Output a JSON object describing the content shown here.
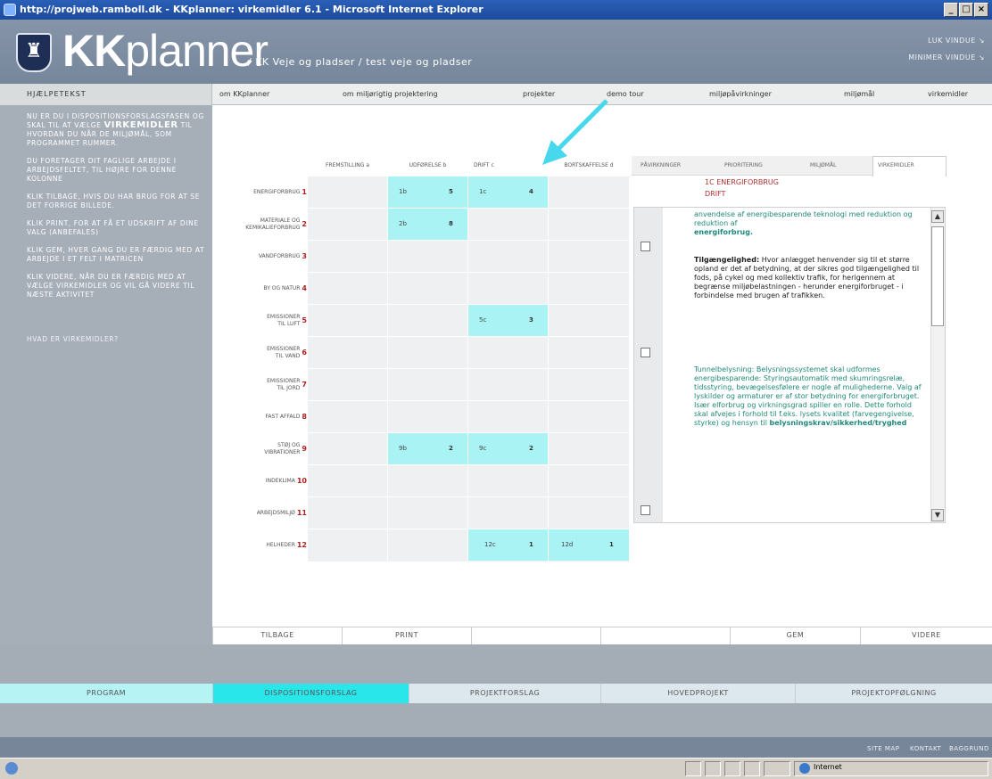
{
  "window": {
    "title": "http://projweb.ramboll.dk - KKplanner: virkemidler 6.1 - Microsoft Internet Explorer"
  },
  "header": {
    "brand_bold": "KK",
    "brand_light": "planner",
    "breadcrumb": "/ KK Veje og pladser  /  test veje og pladser",
    "close_window": "LUK VINDUE ↘",
    "minimize_window": "MINIMER VINDUE ↘",
    "logo": "♜"
  },
  "nav": {
    "help_heading": "HJÆLPETEKST",
    "links": [
      "om KKplanner",
      "om miljørigtig projektering",
      "projekter",
      "demo tour",
      "miljøpåvirkninger",
      "miljømål",
      "virkemidler"
    ]
  },
  "help": {
    "p1_pre": "NU ER DU I DISPOSITIONSFORSLAGSFASEN OG SKAL TIL AT VÆLGE",
    "p1_bold": "VIRKEMIDLER",
    "p1_post": "TIL HVORDAN DU NÅR DE MILJØMÅL, SOM PROGRAMMET RUMMER.",
    "p2": "DU FORETAGER DIT FAGLIGE ARBEJDE I ARBEJDSFELTET, TIL HØJRE FOR DENNE KOLONNE",
    "p3": "KLIK TILBAGE, HVIS DU HAR BRUG FOR AT SE DET FORRIGE BILLEDE.",
    "p4": "KLIK PRINT, FOR AT FÅ ET UDSKRIFT AF DINE VALG (ANBEFALES)",
    "p5": "KLIK GEM, HVER GANG DU ER FÆRDIG MED AT ARBEJDE I ET FELT I MATRICEN",
    "p6": "KLIK VIDERE, NÅR DU ER FÆRDIG MED AT VÆLGE VIRKEMIDLER OG VIL GÅ VIDERE TIL NÆSTE AKTIVITET",
    "link": "HVAD ER VIRKEMIDLER?"
  },
  "matrix": {
    "columns": [
      "FREMSTILLING a",
      "UDFØRELSE b",
      "DRIFT c",
      "BORTSKAFFELSE d"
    ],
    "rows": [
      {
        "label": "ENERGIFORBRUG",
        "num": "1"
      },
      {
        "label": "MATERIALE OG KEMIKALIEFORBRUG",
        "num": "2"
      },
      {
        "label": "VANDFORBRUG",
        "num": "3"
      },
      {
        "label": "BY OG NATUR",
        "num": "4"
      },
      {
        "label": "EMISSIONER TIL LUFT",
        "num": "5"
      },
      {
        "label": "EMISSIONER TIL VAND",
        "num": "6"
      },
      {
        "label": "EMISSIONER TIL JORD",
        "num": "7"
      },
      {
        "label": "FAST AFFALD",
        "num": "8"
      },
      {
        "label": "STØJ OG VIBRATIONER",
        "num": "9"
      },
      {
        "label": "INDEKLIMA",
        "num": "10"
      },
      {
        "label": "ARBEJDSMILJØ",
        "num": "11"
      },
      {
        "label": "HELHEDER",
        "num": "12"
      }
    ],
    "cells": [
      {
        "code": "1b",
        "count": "5"
      },
      {
        "code": "1c",
        "count": "4"
      },
      {
        "code": "2b",
        "count": "8"
      },
      {
        "code": "5c",
        "count": "3"
      },
      {
        "code": "9b",
        "count": "2"
      },
      {
        "code": "9c",
        "count": "2"
      },
      {
        "code": "12c",
        "count": "1"
      },
      {
        "code": "12d",
        "count": "1"
      }
    ]
  },
  "panel": {
    "tabs": [
      "PÅVIRKNINGER",
      "PRIORITERING",
      "MILJØMÅL",
      "VIRKEMIDLER"
    ],
    "heading1": "1C ENERGIFORBRUG",
    "heading2": "DRIFT",
    "t1": "anvendelse af energibesparende teknologi med reduktion og reduktion af",
    "t1b": "energiforbrug.",
    "t2_bold": "Tilgængelighed:",
    "t2": "Hvor anlægget henvender sig til et større opland er det af betydning, at der sikres god tilgængelighed til fods, på cykel og med kollektiv trafik, for herigennem at begrænse miljøbelastningen - herunder energiforbruget - i forbindelse med brugen af",
    "t2_end": "trafikken.",
    "t3": "Tunnelbelysning: Belysningssystemet skal udformes energibesparende: Styringsautomatik med skumringsrelæ, tidsstyring, bevægelsesfølere er nogle af mulighederne. Valg af lyskilder og armaturer er af stor betydning for energiforbruget. Især elforbrug og virkningsgrad spiller en rolle. Dette forhold skal afvejes i forhold til f.eks. lysets kvalitet (farvegengivelse, styrke) og hensyn til",
    "t3_end": "belysningskrav/sikkerhed/tryghed"
  },
  "bottom_nav": [
    "TILBAGE",
    "PRINT",
    "",
    "",
    "GEM",
    "VIDERE"
  ],
  "phases": [
    "PROGRAM",
    "DISPOSITIONSFORSLAG",
    "PROJEKTFORSLAG",
    "HOVEDPROJEKT",
    "PROJEKTOPFØLGNING"
  ],
  "footer_links": [
    "SITE MAP",
    "KONTAKT",
    "BAGGRUND"
  ],
  "status": {
    "zone": "Internet"
  },
  "colors": {
    "cyan_cell": "#aaf3f5",
    "active_phase": "#29e6ea",
    "red_number": "#b32020",
    "green_text": "#1e8a78"
  }
}
